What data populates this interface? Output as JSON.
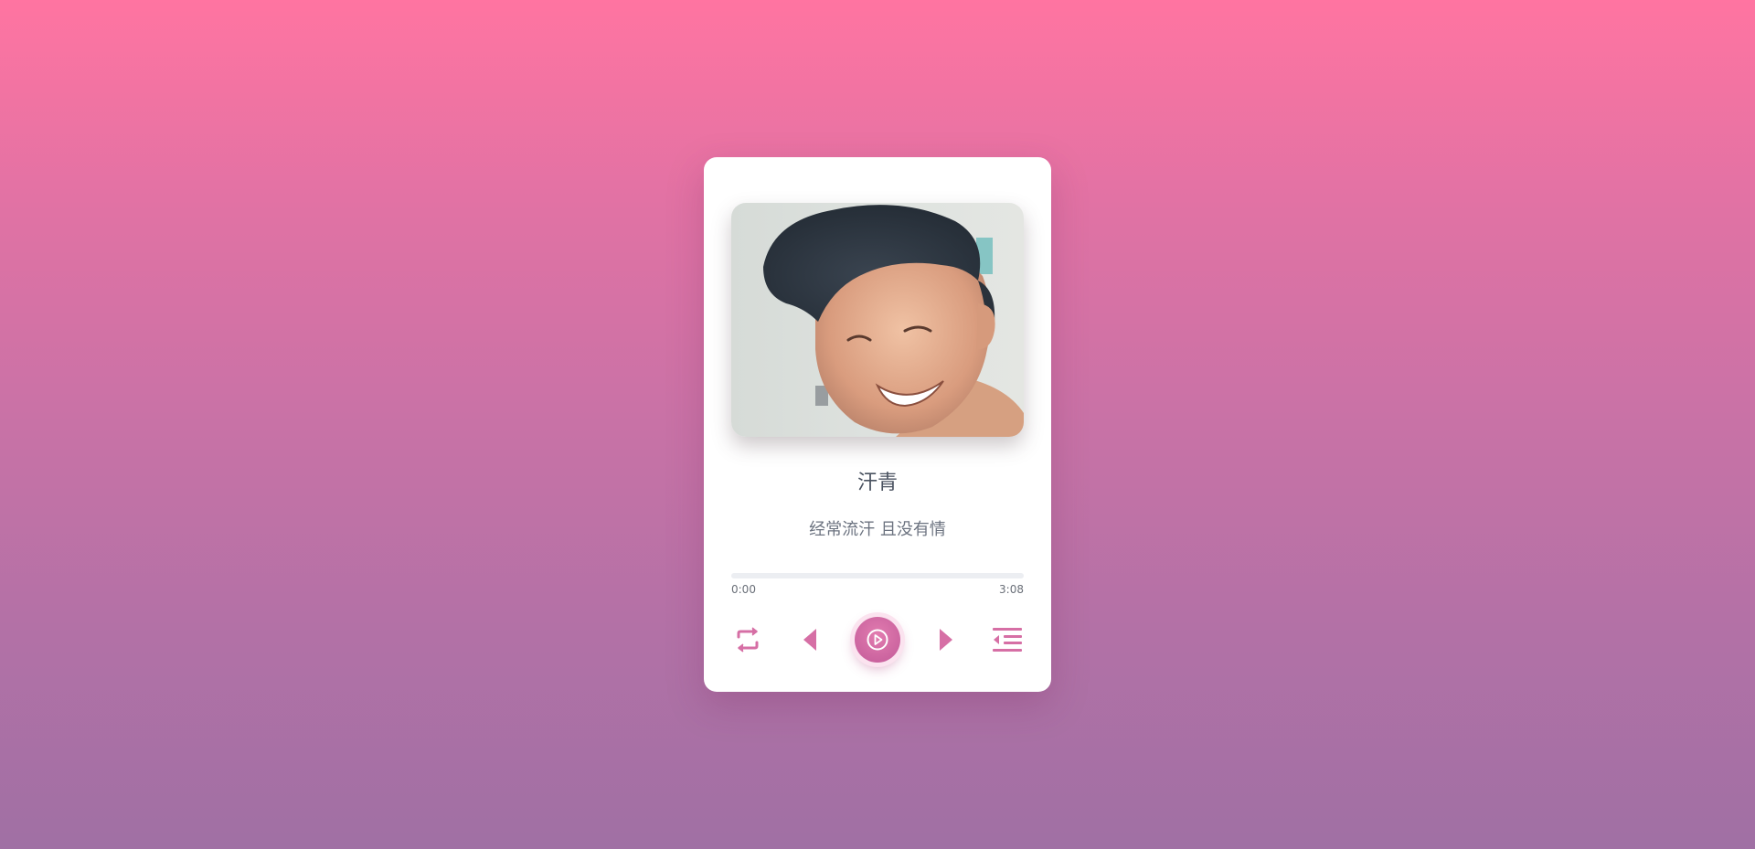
{
  "track": {
    "title": "汗青",
    "subtitle": "经常流汗 且没有情"
  },
  "progress": {
    "current_time": "0:00",
    "total_time": "3:08",
    "fraction": 0
  },
  "colors": {
    "accent": "#d66fa5",
    "title_text": "#4a5260",
    "subtitle_text": "#6c7380",
    "card_bg": "#ffffff",
    "bg_top": "#ff74a1",
    "bg_bottom": "#a070a4"
  },
  "icons": {
    "repeat": "repeat-icon",
    "prev": "previous-icon",
    "play": "play-icon",
    "next": "next-icon",
    "playlist": "playlist-icon"
  }
}
